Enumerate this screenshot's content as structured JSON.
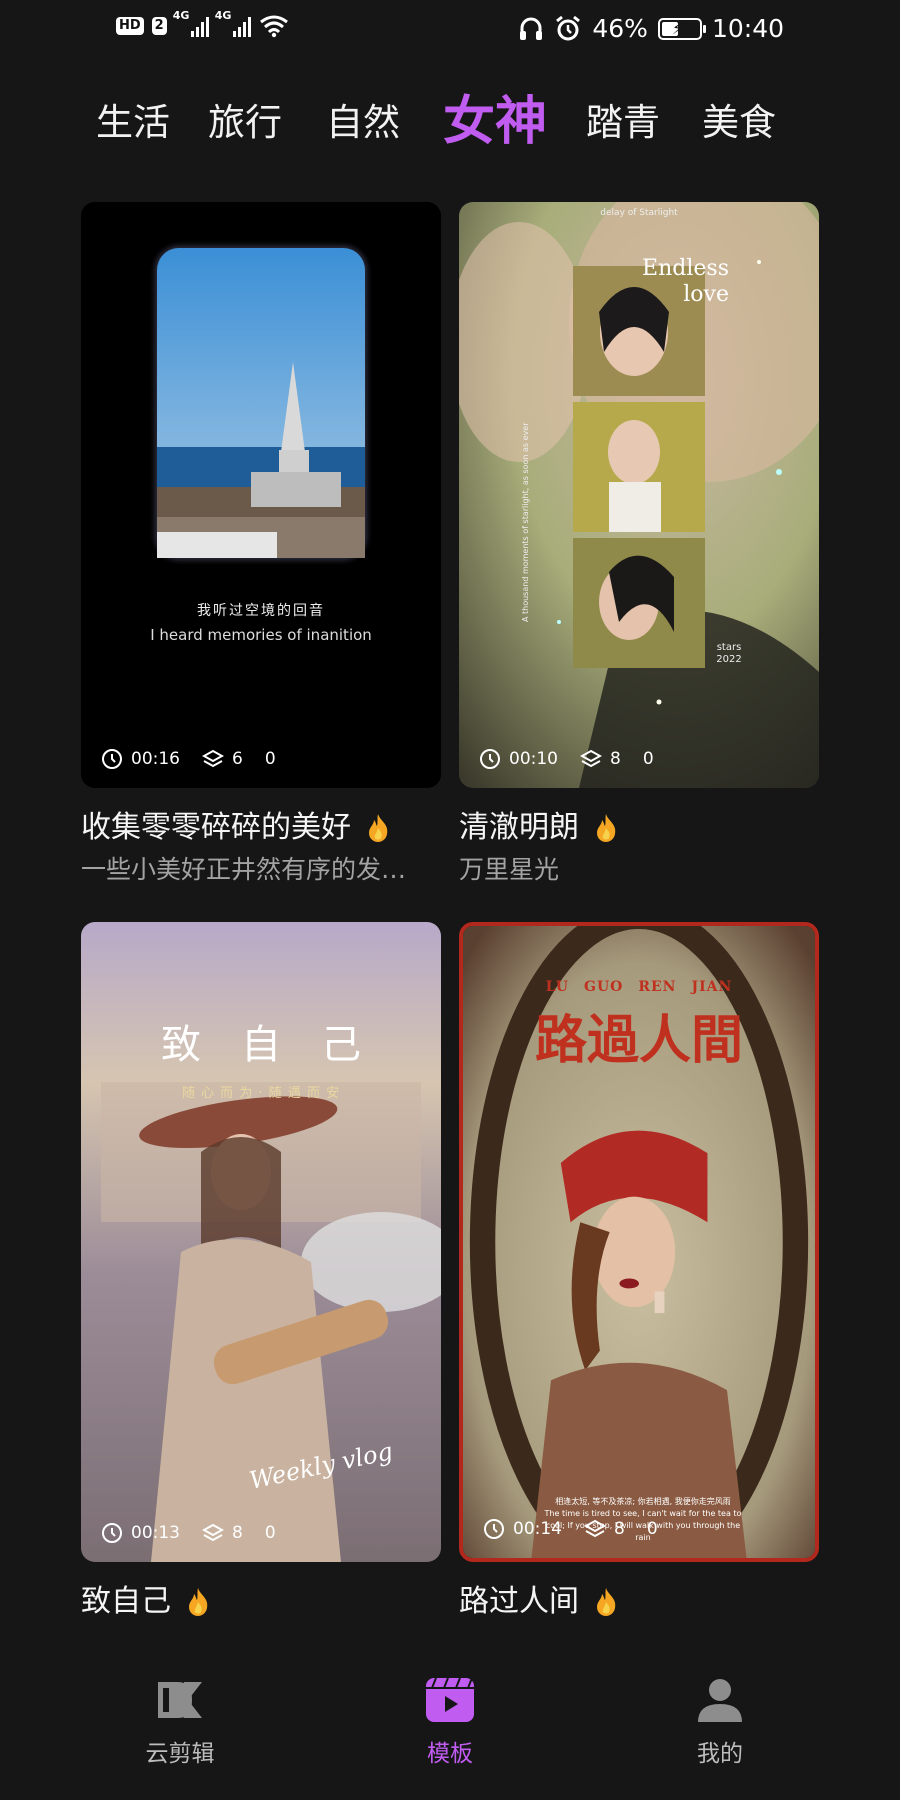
{
  "status_bar": {
    "hd": "HD",
    "sim": "2",
    "net1": "4G",
    "net2": "4G",
    "battery_pct": "46%",
    "battery_level": 0.46,
    "time": "10:40"
  },
  "tabs": [
    {
      "label": "生活",
      "active": false
    },
    {
      "label": "旅行",
      "active": false
    },
    {
      "label": "自然",
      "active": false
    },
    {
      "label": "女神",
      "active": true
    },
    {
      "label": "踏青",
      "active": false
    },
    {
      "label": "美食",
      "active": false
    }
  ],
  "cards": [
    {
      "title": "收集零零碎碎的美好",
      "subtitle": "一些小美好正井然有序的发…",
      "duration": "00:16",
      "layers": "6",
      "count": "0",
      "overlay_cn": "我听过空境的回音",
      "overlay_en": "I heard memories of inanition"
    },
    {
      "title": "清澈明朗",
      "subtitle": "万里星光",
      "duration": "00:10",
      "layers": "8",
      "count": "0",
      "overlay_top": "delay of Starlight",
      "overlay_title_1": "Endless",
      "overlay_title_2": "love",
      "overlay_side": "A thousand moments of starlight, as soon as ever",
      "overlay_stars": "stars",
      "overlay_year": "2022"
    },
    {
      "title": "致自己",
      "subtitle": "",
      "duration": "00:13",
      "layers": "8",
      "count": "0",
      "overlay_big": "致　自　己",
      "overlay_small": "随 心 而 为 · 随 遇 而 安",
      "overlay_script": "Weekly vlog"
    },
    {
      "title": "路过人间",
      "subtitle": "",
      "duration": "00:14",
      "layers": "8",
      "count": "0",
      "overlay_pinyin": "LU　GUO　REN　JIAN",
      "overlay_big": "路過人間",
      "overlay_caption_1": "相逢太短, 等不及茶凉; 你若相遇, 我便你走完风雨",
      "overlay_caption_2": "The time is tired to see, I can't wait for the tea to cool; If you stop, I will walk with you through the rain"
    }
  ],
  "bottom_nav": [
    {
      "label": "云剪辑",
      "icon": "cloud-edit-icon",
      "active": false
    },
    {
      "label": "模板",
      "icon": "template-icon",
      "active": true
    },
    {
      "label": "我的",
      "icon": "profile-icon",
      "active": false
    }
  ],
  "colors": {
    "accent": "#c05cf0",
    "background": "#161616",
    "flame": "#f5a623"
  }
}
